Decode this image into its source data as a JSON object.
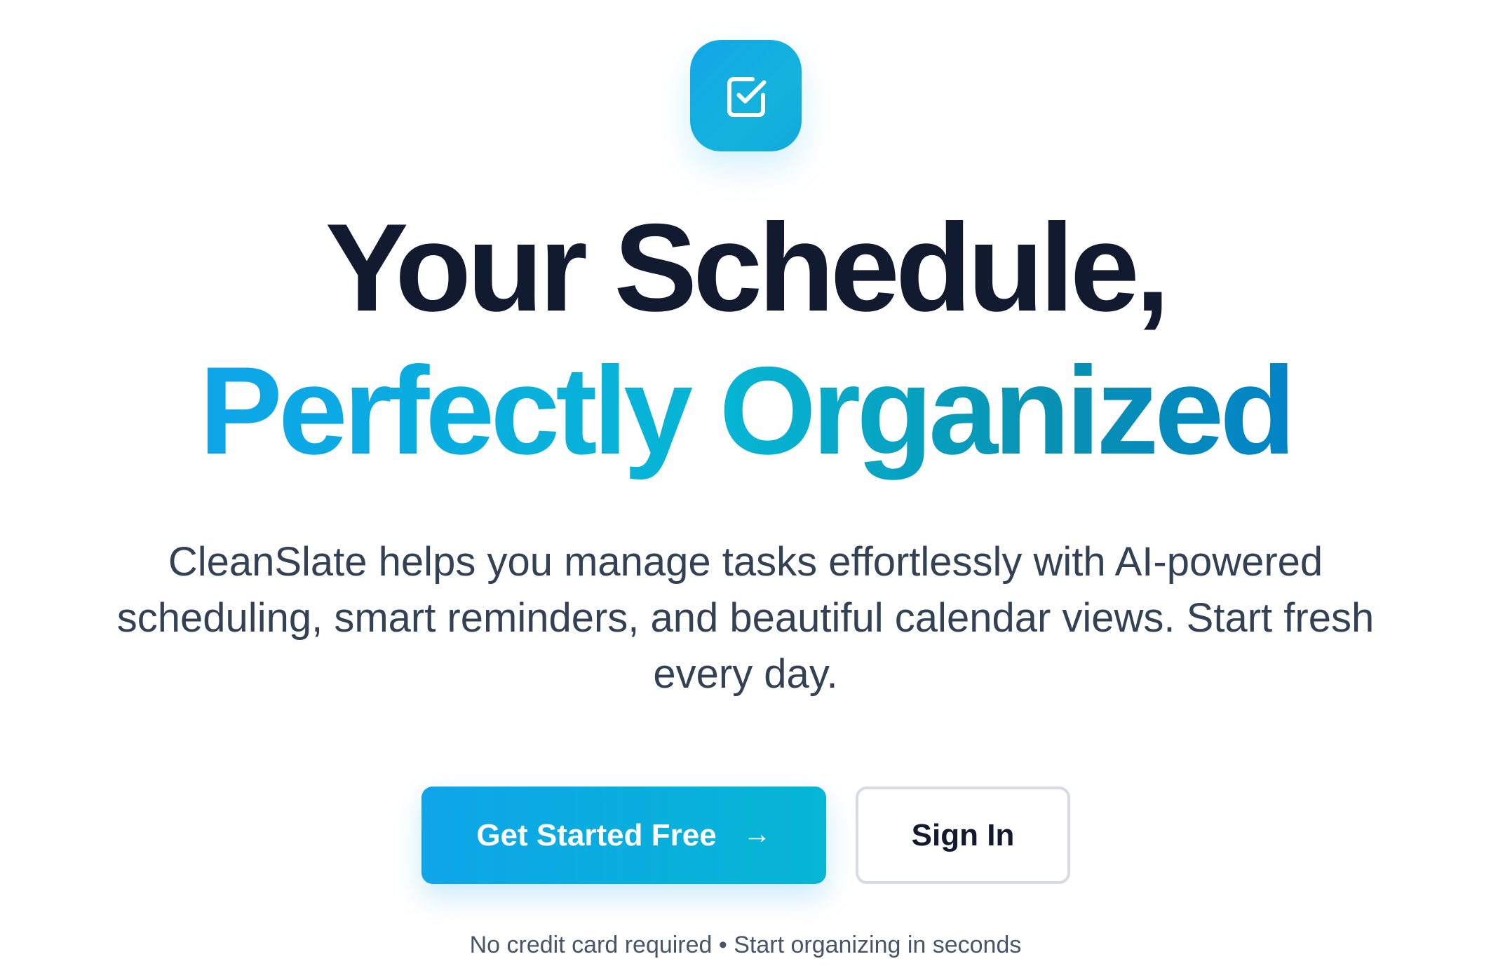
{
  "logo": {
    "icon": "checkbox-check-icon",
    "accent": "#0ea5e9"
  },
  "hero": {
    "headline_line1": "Your Schedule,",
    "headline_line2": "Perfectly Organized",
    "headline_color": "#111a2e",
    "gradient_colors": [
      "#0ea5e9",
      "#06b6d4",
      "#0284c7"
    ],
    "description": "CleanSlate helps you manage tasks effortlessly with AI-powered scheduling, smart reminders, and beautiful calendar views. Start fresh every day."
  },
  "cta": {
    "primary_label": "Get Started Free",
    "primary_icon": "arrow-right-icon",
    "secondary_label": "Sign In"
  },
  "footnote": {
    "text": "No credit card required • Start organizing in seconds"
  }
}
